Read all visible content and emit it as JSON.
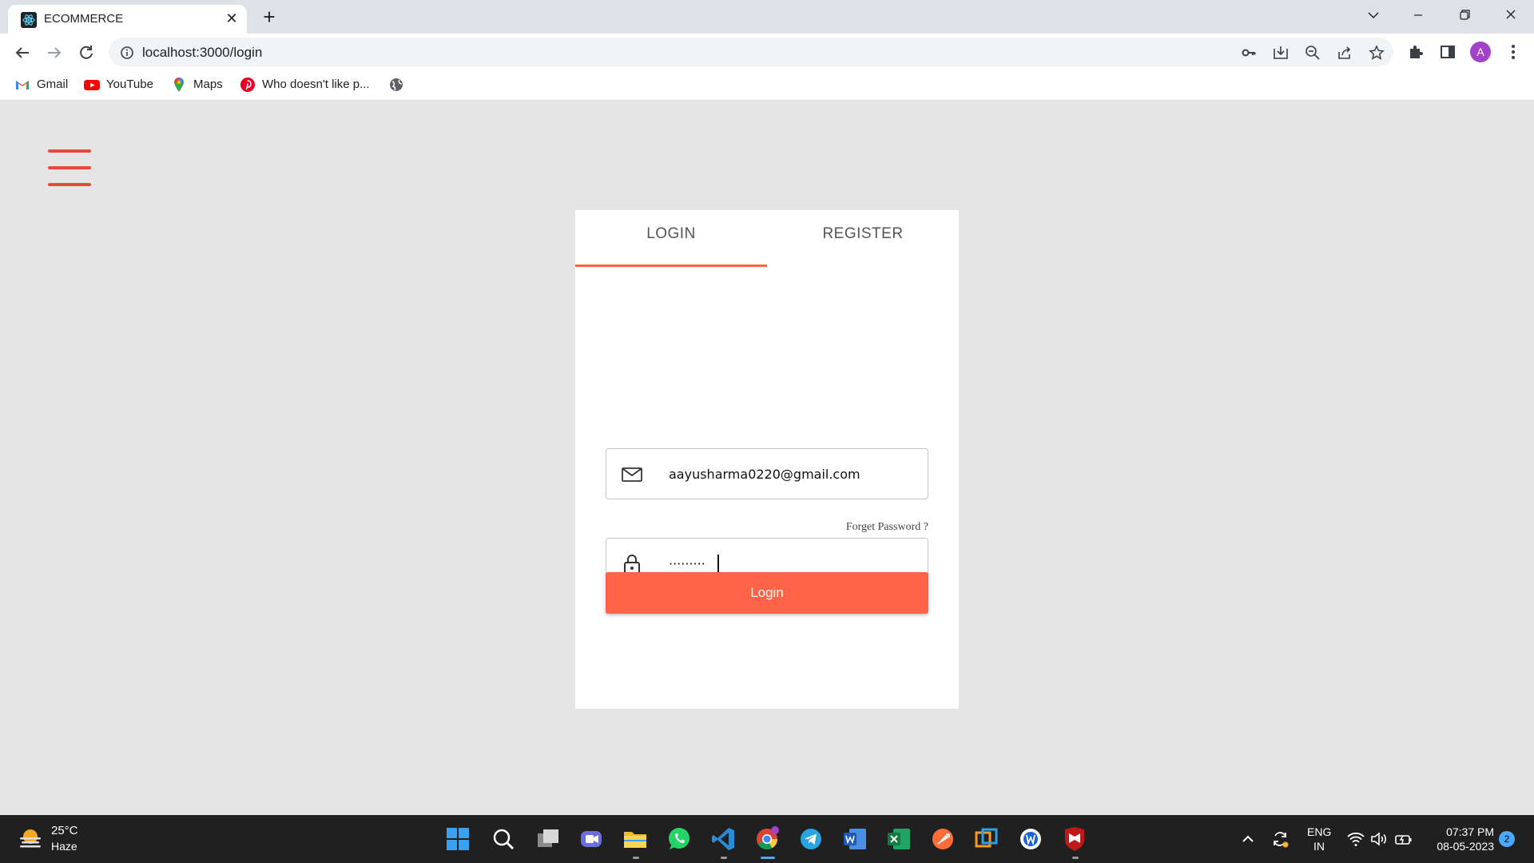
{
  "browser": {
    "tab_title": "ECOMMERCE",
    "tab_close": "✕",
    "new_tab": "+",
    "url": "localhost:3000/login",
    "profile_initial": "A",
    "bookmarks": [
      {
        "label": "Gmail",
        "icon": "gmail-icon"
      },
      {
        "label": "YouTube",
        "icon": "youtube-icon"
      },
      {
        "label": "Maps",
        "icon": "maps-icon"
      },
      {
        "label": "Who doesn't like p...",
        "icon": "pinterest-icon"
      },
      {
        "label": "",
        "icon": "globe-icon"
      }
    ]
  },
  "page": {
    "tabs": [
      {
        "label": "LOGIN",
        "active": true
      },
      {
        "label": "REGISTER",
        "active": false
      }
    ],
    "email": {
      "value": "aayusharma0220@gmail.com",
      "icon": "mail-icon"
    },
    "password": {
      "masked_value": "·········",
      "icon": "lock-icon"
    },
    "forget_password": "Forget Password ?",
    "login_button": "Login"
  },
  "taskbar": {
    "weather_temp": "25°C",
    "weather_desc": "Haze",
    "lang_line1": "ENG",
    "lang_line2": "IN",
    "time": "07:37 PM",
    "date": "08-05-2023",
    "notification_count": "2"
  },
  "colors": {
    "accent": "#ff6347",
    "hamburger": "#e64a3a",
    "page_bg": "#e5e5e5",
    "profile": "#a142c8"
  }
}
